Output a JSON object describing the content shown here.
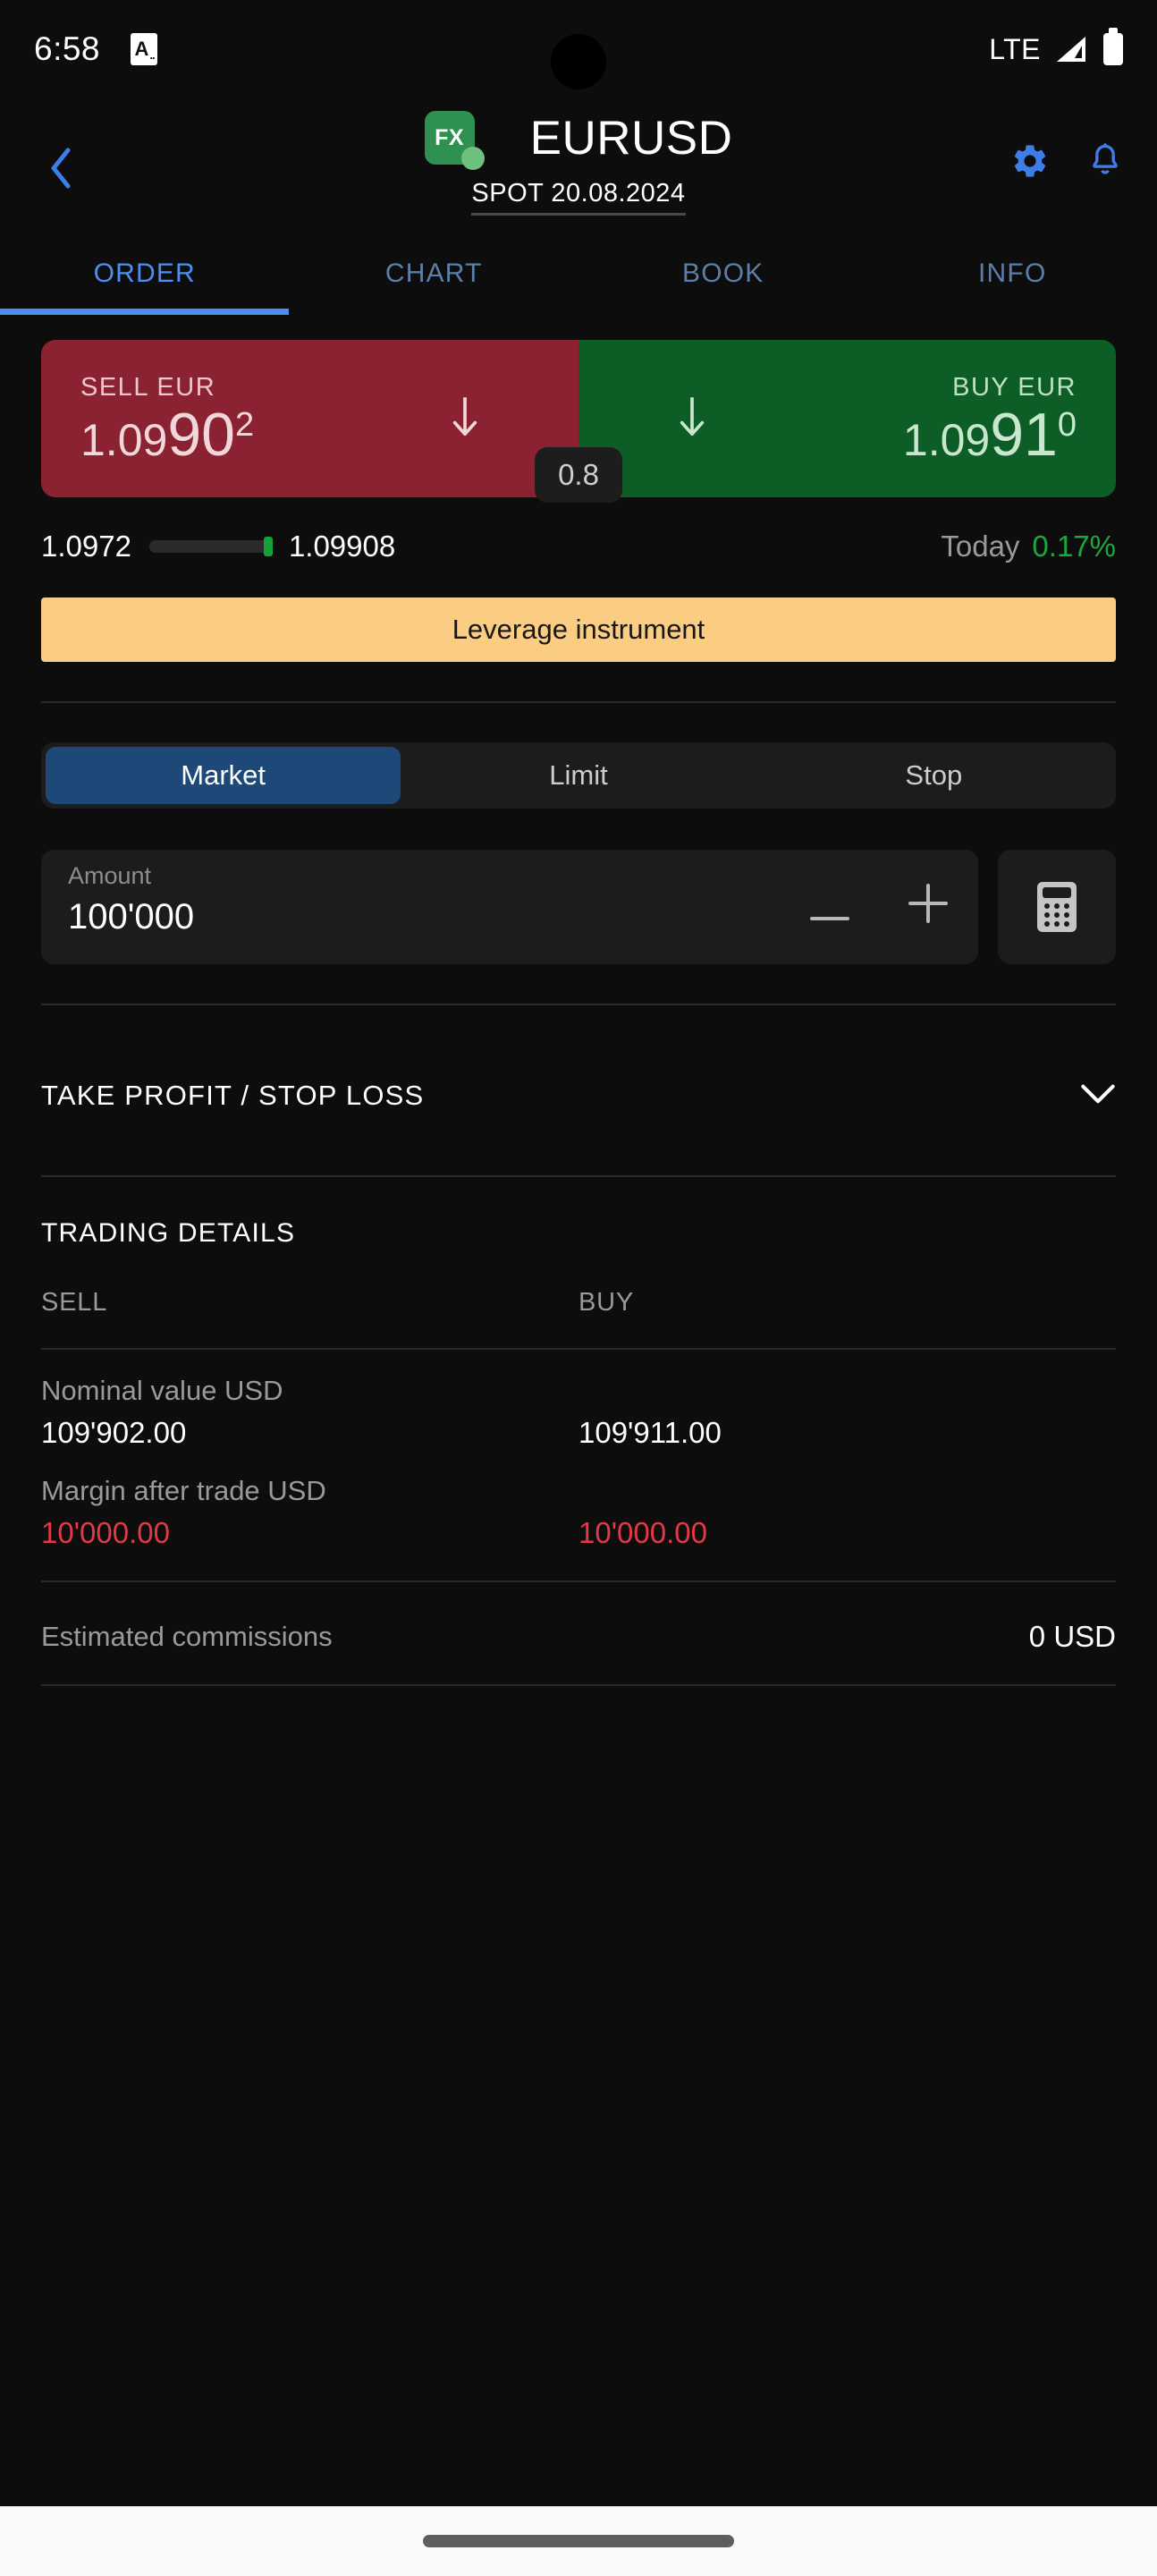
{
  "status_bar": {
    "time": "6:58",
    "app_icon_letter": "A",
    "network": "LTE",
    "icons": [
      "app-notification-icon",
      "signal-icon",
      "battery-icon"
    ]
  },
  "header": {
    "back_icon": "chevron-left-icon",
    "badge_text": "FX",
    "title": "EURUSD",
    "subtitle": "SPOT 20.08.2024",
    "settings_icon": "gear-icon",
    "alerts_icon": "bell-icon"
  },
  "tabs": {
    "items": [
      {
        "label": "ORDER",
        "active": true
      },
      {
        "label": "CHART",
        "active": false
      },
      {
        "label": "BOOK",
        "active": false
      },
      {
        "label": "INFO",
        "active": false
      }
    ]
  },
  "price_panel": {
    "sell": {
      "label": "SELL EUR",
      "price_small": "1.09",
      "price_big": "90",
      "price_sup": "2",
      "full_price": "1.09902",
      "arrow": "arrow-down-icon",
      "color": "#8b2232"
    },
    "buy": {
      "label": "BUY EUR",
      "price_small": "1.09",
      "price_big": "91",
      "price_sup": "0",
      "full_price": "1.09910",
      "arrow": "arrow-down-icon",
      "color": "#0d5d26"
    },
    "spread": "0.8"
  },
  "range": {
    "low": "1.0972",
    "high": "1.09908",
    "today_label": "Today",
    "today_change": "0.17%",
    "today_color": "#1da83c",
    "marker_position_pct": 98
  },
  "leverage_banner": {
    "text": "Leverage instrument",
    "background": "#fbcd82"
  },
  "order_type": {
    "options": [
      {
        "label": "Market",
        "active": true
      },
      {
        "label": "Limit",
        "active": false
      },
      {
        "label": "Stop",
        "active": false
      }
    ],
    "active_color": "#1d4877"
  },
  "amount": {
    "label": "Amount",
    "value": "100'000",
    "decrement_icon": "minus-icon",
    "increment_icon": "plus-icon",
    "calculator_icon": "calculator-icon"
  },
  "take_profit_stop_loss": {
    "label": "TAKE PROFIT / STOP LOSS",
    "chevron_icon": "chevron-down-icon"
  },
  "trading_details": {
    "title": "TRADING DETAILS",
    "columns": [
      "SELL",
      "BUY"
    ],
    "rows": [
      {
        "label": "Nominal value USD",
        "sell": "109'902.00",
        "buy": "109'911.00",
        "value_color": "#ffffff"
      },
      {
        "label": "Margin after trade USD",
        "sell": "10'000.00",
        "buy": "10'000.00",
        "value_color": "#e03a46"
      }
    ],
    "commissions_label": "Estimated commissions",
    "commissions_value": "0 USD"
  }
}
